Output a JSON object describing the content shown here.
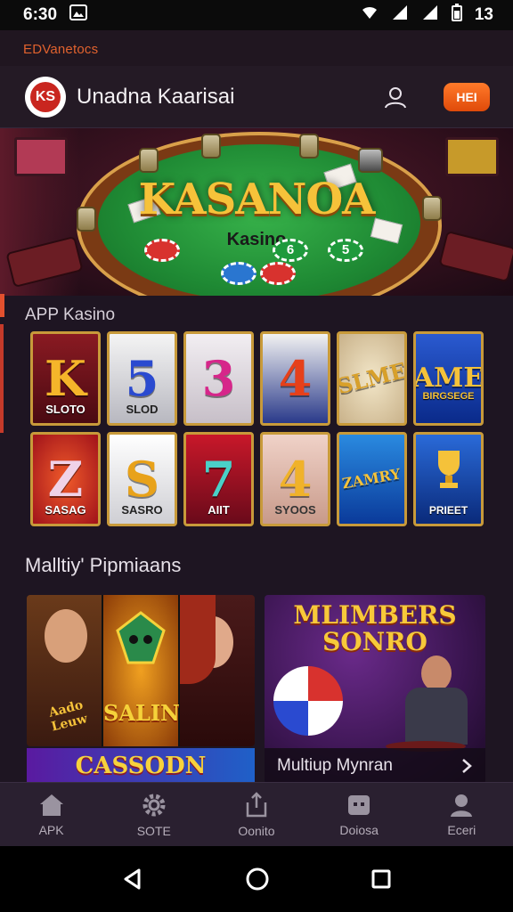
{
  "status_bar": {
    "time": "6:30",
    "battery": "13"
  },
  "brand_strip": "EDVanetocs",
  "header": {
    "title": "Unadna Kaarisai",
    "logo_text": "KS",
    "cta_label": "HEI"
  },
  "hero": {
    "title": "KASANOA",
    "subtitle": "Kasino",
    "chips": [
      "6",
      "5"
    ]
  },
  "section1": {
    "label": "APP Kasino"
  },
  "games": [
    {
      "symbol": "K",
      "label": "SLOTO"
    },
    {
      "symbol": "5",
      "label": "SLOD"
    },
    {
      "symbol": "3",
      "label": ""
    },
    {
      "symbol": "4",
      "label": ""
    },
    {
      "symbol": "SLME",
      "label": ""
    },
    {
      "symbol": "AME",
      "label": "BIRGSEGE"
    },
    {
      "symbol": "Z",
      "label": "SASAG"
    },
    {
      "symbol": "S",
      "label": "SASRO"
    },
    {
      "symbol": "7",
      "label": "AIIT"
    },
    {
      "symbol": "4",
      "label": "SYOOS"
    },
    {
      "symbol": "ZAMRY",
      "label": ""
    },
    {
      "symbol": "",
      "label": "PRIEET"
    }
  ],
  "promotions": {
    "title": "Malltiy' Pipmiaans",
    "left_panel_center_text": "SALIN",
    "left_panel_left_text": "Aado Leuw",
    "left_banner": "CASSODN",
    "right_title_line1": "MLIMBERS",
    "right_title_line2": "SONRO",
    "right_caption": "Multiup Mynran"
  },
  "bottom_nav": [
    {
      "label": "APK",
      "icon": "home-icon"
    },
    {
      "label": "SOTE",
      "icon": "gear-icon"
    },
    {
      "label": "Oonito",
      "icon": "share-icon"
    },
    {
      "label": "Doiosa",
      "icon": "wallet-icon"
    },
    {
      "label": "Eceri",
      "icon": "person-icon"
    }
  ],
  "colors": {
    "accent": "#e3502e",
    "background": "#1e1522",
    "gold_border": "#c89a3a",
    "cta": "#f06a1a"
  }
}
